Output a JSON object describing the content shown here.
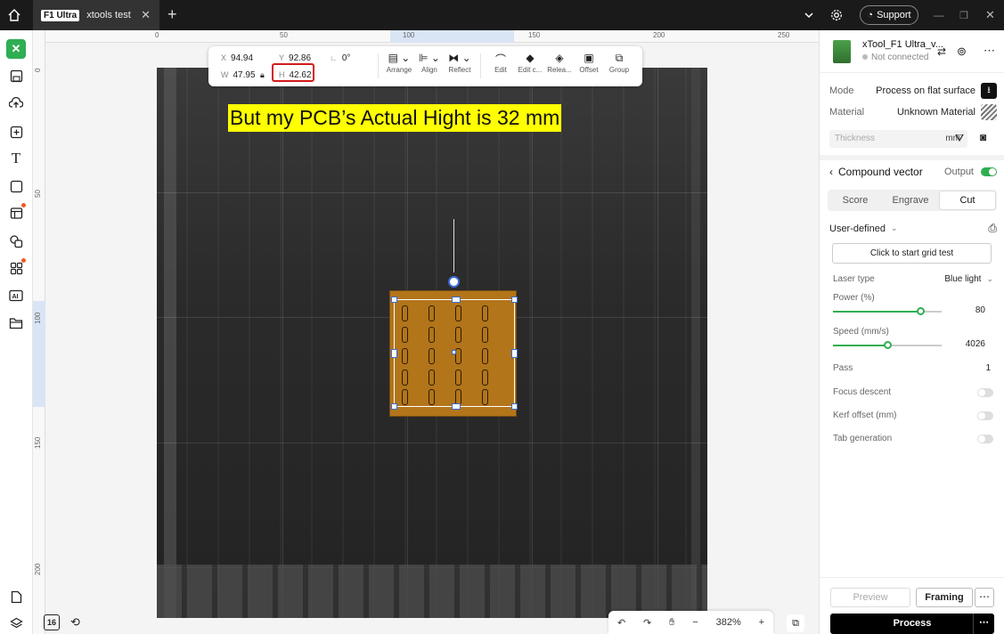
{
  "titlebar": {
    "tab_badge": "F1 Ultra",
    "tab_title": "xtools test",
    "support_label": "Support"
  },
  "rulers": {
    "top_ticks": [
      "0",
      "50",
      "100",
      "150",
      "200",
      "250"
    ],
    "left_ticks": [
      "0",
      "50",
      "100",
      "150",
      "200"
    ]
  },
  "canvas": {
    "caption": "But my PCB’s Actual Hight is 32 mm"
  },
  "propbar": {
    "x_label": "X",
    "x_value": "94.94",
    "y_label": "Y",
    "y_value": "92.86",
    "w_label": "W",
    "w_value": "47.95",
    "h_label": "H",
    "h_value": "42.62",
    "angle_value": "0°",
    "tools": [
      "Arrange",
      "Align",
      "Reflect",
      "Edit",
      "Edit c...",
      "Relea...",
      "Offset",
      "Group"
    ]
  },
  "zoom": {
    "level": "382%"
  },
  "left_bottom_badge": "16",
  "device": {
    "name": "xTool_F1 Ultra_v...",
    "status": "Not connected"
  },
  "settings": {
    "mode_label": "Mode",
    "mode_value": "Process on flat surface",
    "material_label": "Material",
    "material_value": "Unknown Material",
    "thickness_placeholder": "Thickness",
    "thickness_unit": "mm"
  },
  "layer": {
    "title": "Compound vector",
    "output_label": "Output",
    "output_on": true,
    "tabs": [
      "Score",
      "Engrave",
      "Cut"
    ],
    "active_tab": "Cut",
    "preset": "User-defined",
    "grid_test_label": "Click to start grid test",
    "laser_type_label": "Laser type",
    "laser_type_value": "Blue light",
    "power_label": "Power (%)",
    "power_value": "80",
    "power_fraction": 0.8,
    "speed_label": "Speed (mm/s)",
    "speed_value": "4026",
    "speed_fraction": 0.5,
    "pass_label": "Pass",
    "pass_value": "1",
    "focus_label": "Focus descent",
    "kerf_label": "Kerf offset (mm)",
    "tab_gen_label": "Tab generation"
  },
  "actions": {
    "preview": "Preview",
    "framing": "Framing",
    "process": "Process"
  },
  "colors": {
    "accent": "#2fae52",
    "caption_bg": "#ffff00",
    "highlight_outline": "#d11a1a"
  }
}
